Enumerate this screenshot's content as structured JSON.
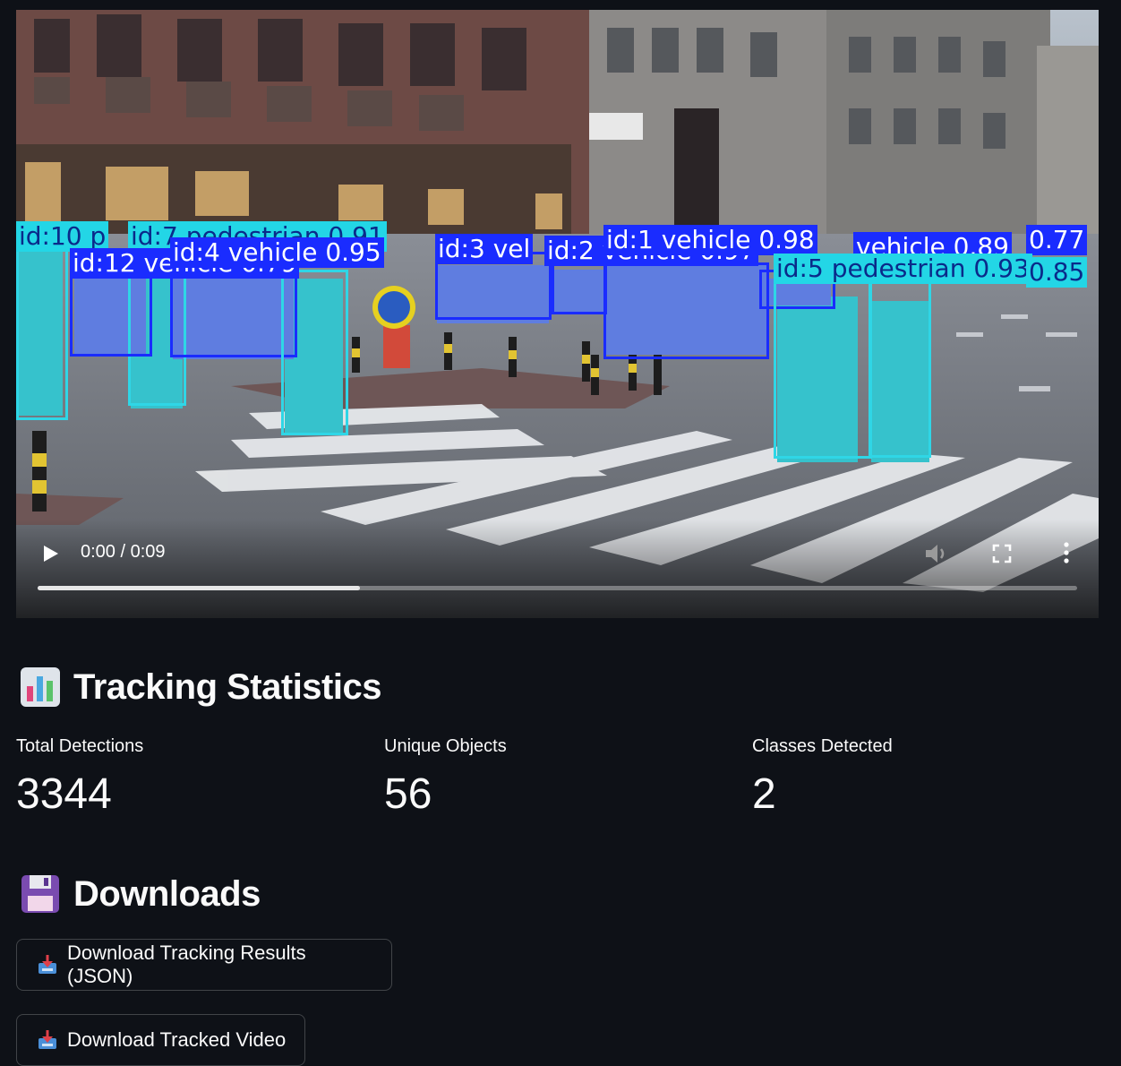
{
  "video": {
    "time_display": "0:00 / 0:09",
    "progress_buffered": 0.31,
    "detections": [
      {
        "label": "id:10 p",
        "class": "ped"
      },
      {
        "label": "id:7 pedestrian 0.91",
        "class": "ped"
      },
      {
        "label": "id:12 vehicle 0.79",
        "class": "veh"
      },
      {
        "label": "id:4 vehicle 0.95",
        "class": "veh"
      },
      {
        "label": "id:3 vel",
        "class": "veh"
      },
      {
        "label": "id:2 vehicle 0.97",
        "class": "veh"
      },
      {
        "label": "id:1 vehicle 0.98",
        "class": "veh"
      },
      {
        "label": "vehicle 0.89",
        "class": "veh"
      },
      {
        "label": "0.77",
        "class": "veh"
      },
      {
        "label": "id:5 pedestrian 0.93",
        "class": "ped"
      },
      {
        "label": "0.85",
        "class": "ped"
      }
    ]
  },
  "stats": {
    "title": "Tracking Statistics",
    "icon": "bar-chart-icon",
    "metrics": [
      {
        "label": "Total Detections",
        "value": "3344"
      },
      {
        "label": "Unique Objects",
        "value": "56"
      },
      {
        "label": "Classes Detected",
        "value": "2"
      }
    ]
  },
  "downloads": {
    "title": "Downloads",
    "icon": "floppy-disk-icon",
    "buttons": [
      {
        "label": "Download Tracking Results (JSON)",
        "icon": "inbox-tray-icon"
      },
      {
        "label": "Download Tracked Video",
        "icon": "inbox-tray-icon"
      }
    ]
  },
  "colors": {
    "background": "#0e1117",
    "vehicle_box": "#1a2cff",
    "pedestrian_box": "#2fd6e6"
  }
}
